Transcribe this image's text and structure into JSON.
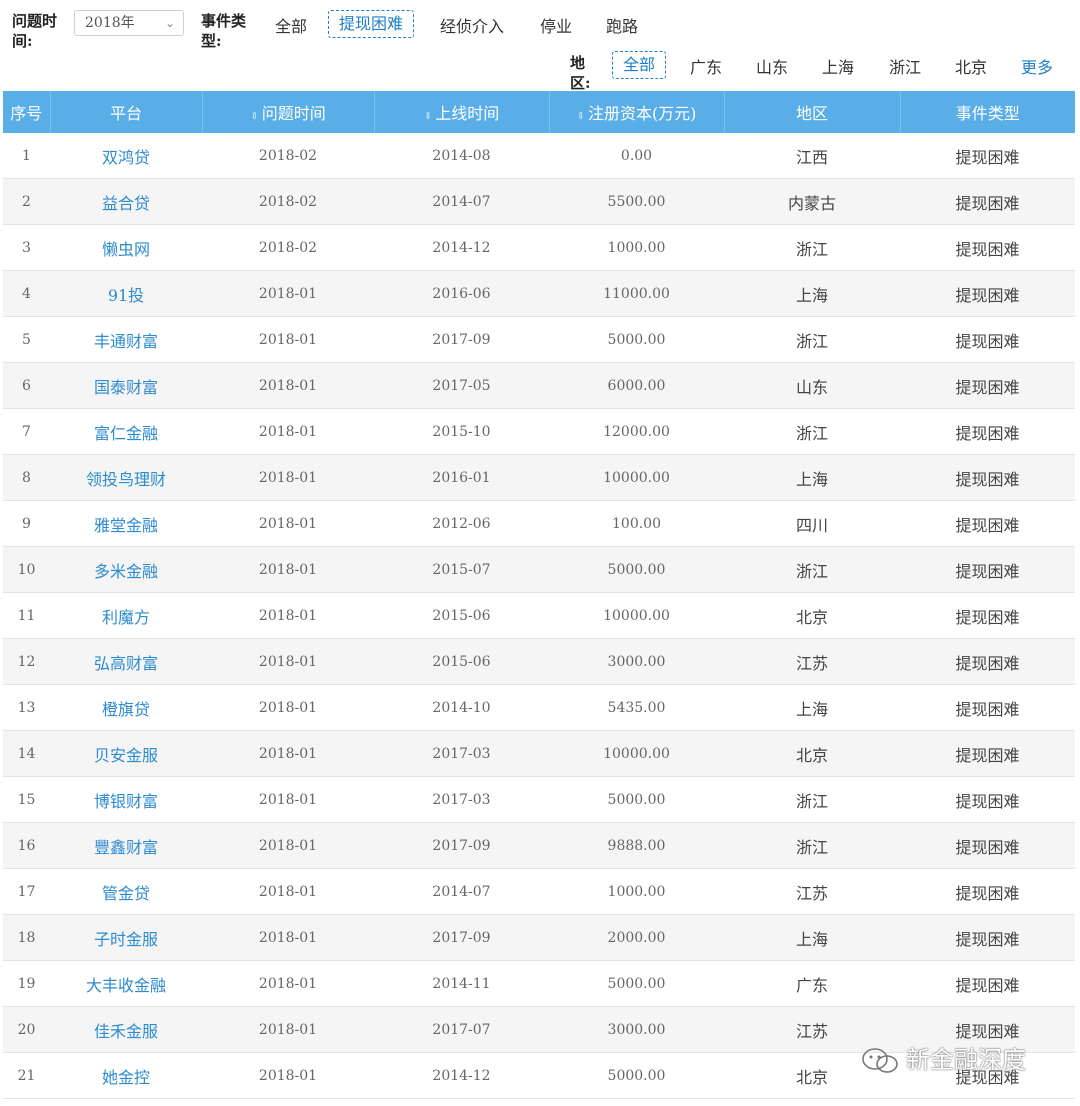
{
  "filters": {
    "time_label": "问题时\n间:",
    "time_label_line1": "问题时",
    "time_label_line2": "间:",
    "year_value": "2018年",
    "type_label_line1": "事件类",
    "type_label_line2": "型:",
    "event_types": [
      "全部",
      "提现困难",
      "经侦介入",
      "停业",
      "跑路"
    ],
    "event_type_selected": "提现困难",
    "region_label_line1": "地",
    "region_label_line2": "区:",
    "regions": [
      "全部",
      "广东",
      "山东",
      "上海",
      "浙江",
      "北京"
    ],
    "region_selected": "全部",
    "more_label": "更多"
  },
  "table": {
    "headers": [
      "序号",
      "平台",
      "问题时间",
      "上线时间",
      "注册资本(万元)",
      "地区",
      "事件类型"
    ],
    "rows": [
      [
        "1",
        "双鸿贷",
        "2018-02",
        "2014-08",
        "0.00",
        "江西",
        "提现困难"
      ],
      [
        "2",
        "益合贷",
        "2018-02",
        "2014-07",
        "5500.00",
        "内蒙古",
        "提现困难"
      ],
      [
        "3",
        "懒虫网",
        "2018-02",
        "2014-12",
        "1000.00",
        "浙江",
        "提现困难"
      ],
      [
        "4",
        "91投",
        "2018-01",
        "2016-06",
        "11000.00",
        "上海",
        "提现困难"
      ],
      [
        "5",
        "丰通财富",
        "2018-01",
        "2017-09",
        "5000.00",
        "浙江",
        "提现困难"
      ],
      [
        "6",
        "国泰财富",
        "2018-01",
        "2017-05",
        "6000.00",
        "山东",
        "提现困难"
      ],
      [
        "7",
        "富仁金融",
        "2018-01",
        "2015-10",
        "12000.00",
        "浙江",
        "提现困难"
      ],
      [
        "8",
        "领投鸟理财",
        "2018-01",
        "2016-01",
        "10000.00",
        "上海",
        "提现困难"
      ],
      [
        "9",
        "雅堂金融",
        "2018-01",
        "2012-06",
        "100.00",
        "四川",
        "提现困难"
      ],
      [
        "10",
        "多米金融",
        "2018-01",
        "2015-07",
        "5000.00",
        "浙江",
        "提现困难"
      ],
      [
        "11",
        "利魔方",
        "2018-01",
        "2015-06",
        "10000.00",
        "北京",
        "提现困难"
      ],
      [
        "12",
        "弘高财富",
        "2018-01",
        "2015-06",
        "3000.00",
        "江苏",
        "提现困难"
      ],
      [
        "13",
        "橙旗贷",
        "2018-01",
        "2014-10",
        "5435.00",
        "上海",
        "提现困难"
      ],
      [
        "14",
        "贝安金服",
        "2018-01",
        "2017-03",
        "10000.00",
        "北京",
        "提现困难"
      ],
      [
        "15",
        "博银财富",
        "2018-01",
        "2017-03",
        "5000.00",
        "浙江",
        "提现困难"
      ],
      [
        "16",
        "豐鑫财富",
        "2018-01",
        "2017-09",
        "9888.00",
        "浙江",
        "提现困难"
      ],
      [
        "17",
        "管金贷",
        "2018-01",
        "2014-07",
        "1000.00",
        "江苏",
        "提现困难"
      ],
      [
        "18",
        "子时金服",
        "2018-01",
        "2017-09",
        "2000.00",
        "上海",
        "提现困难"
      ],
      [
        "19",
        "大丰收金融",
        "2018-01",
        "2014-11",
        "5000.00",
        "广东",
        "提现困难"
      ],
      [
        "20",
        "佳禾金服",
        "2018-01",
        "2017-07",
        "3000.00",
        "江苏",
        "提现困难"
      ],
      [
        "21",
        "她金控",
        "2018-01",
        "2014-12",
        "5000.00",
        "北京",
        "提现困难"
      ]
    ]
  },
  "watermark": {
    "text": "新金融深度",
    "icon": "wechat-icon"
  },
  "colors": {
    "header_bg": "#5aaee8",
    "link": "#2d8bd0",
    "active": "#1e7fc8"
  }
}
